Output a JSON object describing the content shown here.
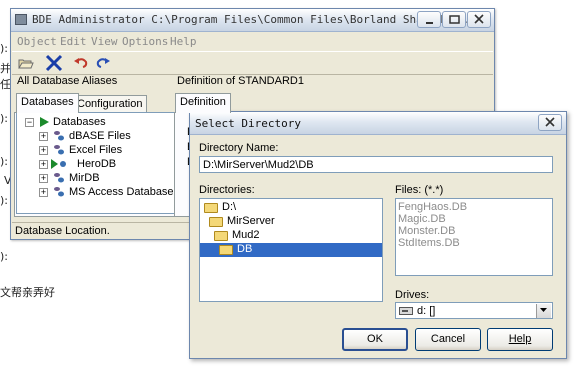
{
  "background": {
    "fragments": [
      "):",
      "并",
      "任",
      "):",
      "):",
      "V",
      "):",
      "):",
      "文帮亲弄好"
    ]
  },
  "bde": {
    "title": "BDE Administrator  C:\\Program Files\\Common Files\\Borland Shared\\BD...",
    "menu": [
      "Object",
      "Edit",
      "View",
      "Options",
      "Help"
    ],
    "left_header": "All Database Aliases",
    "right_header": "Definition of STANDARD1",
    "tabs": [
      "Databases",
      "Configuration"
    ],
    "right_tab": "Definition",
    "tree": [
      {
        "label": "Databases",
        "icon": "databases-root-icon"
      },
      {
        "label": "dBASE Files",
        "icon": "database-alias-icon"
      },
      {
        "label": "Excel Files",
        "icon": "database-alias-icon"
      },
      {
        "label": "HeroDB",
        "icon": "database-alias-active-icon"
      },
      {
        "label": "MirDB",
        "icon": "database-alias-icon"
      },
      {
        "label": "MS Access Database",
        "icon": "database-alias-icon"
      }
    ],
    "def_letters": [
      "D",
      "E",
      "D"
    ],
    "status": "Database Location."
  },
  "dialog": {
    "title": "Select Directory",
    "dir_name_label": "Directory Name:",
    "dir_name_value": "D:\\MirServer\\Mud2\\DB",
    "directories_label": "Directories:",
    "directories": [
      "D:\\",
      "MirServer",
      "Mud2",
      "DB"
    ],
    "selected_directory": "DB",
    "files_label": "Files: (*.*)",
    "files": [
      "FengHaos.DB",
      "Magic.DB",
      "Monster.DB",
      "StdItems.DB"
    ],
    "drives_label": "Drives:",
    "drive_value": "d: []",
    "buttons": {
      "ok": "OK",
      "cancel": "Cancel",
      "help": "Help"
    },
    "colors": {
      "selection": "#316ac5",
      "folder": "#f4d878"
    }
  }
}
